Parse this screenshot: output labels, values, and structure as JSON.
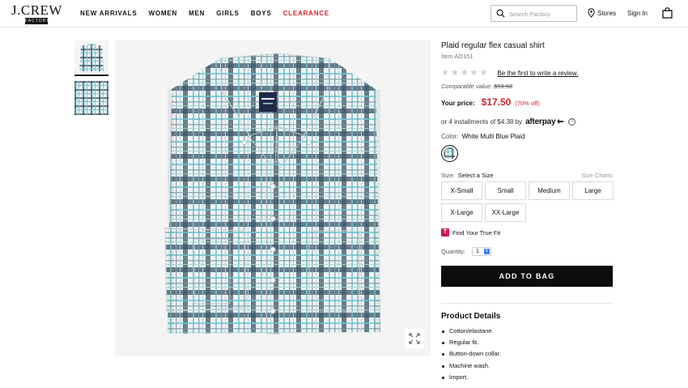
{
  "header": {
    "logo_main": "J.CREW",
    "logo_sub": "FACTORY",
    "nav": [
      "NEW ARRIVALS",
      "WOMEN",
      "MEN",
      "GIRLS",
      "BOYS",
      "CLEARANCE"
    ],
    "search_placeholder": "Search Factory",
    "stores_label": "Stores",
    "signin_label": "Sign In",
    "accent_sale": "#d0262d"
  },
  "product": {
    "title": "Plaid regular flex casual shirt",
    "item_no": "Item AO151",
    "review_link": "Be the first to write a review.",
    "rating_stars": 5,
    "comparable_label": "Comparable value:",
    "comparable_value": "$59.50",
    "price_label": "Your price:",
    "price": "$17.50",
    "discount": "(70% off)",
    "afterpay_text": "or 4 installments of $4.38 by",
    "afterpay_brand": "afterpay",
    "color_label": "Color:",
    "color_value": "White Multi Blue Plaid",
    "size_label": "Size:",
    "size_value": "Select a Size",
    "size_charts": "Size Charts",
    "sizes": [
      "X-Small",
      "Small",
      "Medium",
      "Large",
      "X-Large",
      "XX-Large"
    ],
    "truefit_label": "Find Your True Fit",
    "quantity_label": "Quantity:",
    "quantity_value": "1",
    "add_to_bag": "ADD TO BAG",
    "details_title": "Product Details",
    "details": [
      "Cotton/elastane.",
      "Regular fit.",
      "Button-down collar.",
      "Machine wash.",
      "Import."
    ]
  },
  "icons": [
    "search-icon",
    "location-pin-icon",
    "shopping-bag-icon",
    "expand-icon",
    "info-icon",
    "truefit-icon",
    "star-icon"
  ],
  "colors": {
    "price_red": "#d0262d",
    "button_black": "#0c0c0c",
    "plaid_navy": "#2e4a5a",
    "plaid_teal": "#6fc3cc"
  }
}
